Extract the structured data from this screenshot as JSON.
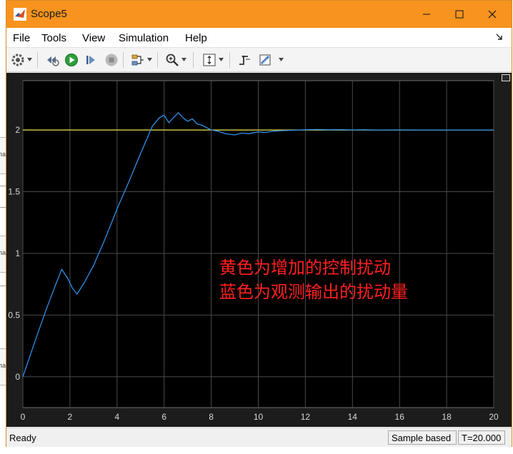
{
  "window": {
    "title": "Scope5"
  },
  "menu": [
    "File",
    "Tools",
    "View",
    "Simulation",
    "Help"
  ],
  "toolbar": {
    "icons": [
      "gear-icon",
      "restore-sim-icon",
      "run-icon",
      "step-forward-icon",
      "stop-icon",
      "signal-highlight-icon",
      "zoom-icon",
      "autoscale-icon",
      "trigger-icon",
      "measure-icon"
    ]
  },
  "annotation": {
    "line1": "黄色为增加的控制扰动",
    "line2": "蓝色为观测输出的扰动量"
  },
  "status": {
    "ready": "Ready",
    "mode": "Sample based",
    "time": "T=20.000"
  },
  "colors": {
    "title_bar": "#f7931e",
    "plot_bg": "#000000",
    "grid": "#4a4a4a",
    "series_blue": "#2e8fe6",
    "series_yellow": "#e8e24a",
    "annotation": "#ff2020"
  },
  "chart_data": {
    "type": "line",
    "xlim": [
      0,
      20
    ],
    "ylim": [
      -0.25,
      2.4
    ],
    "xticks": [
      0,
      2,
      4,
      6,
      8,
      10,
      12,
      14,
      16,
      18,
      20
    ],
    "yticks": [
      0,
      0.5,
      1,
      1.5,
      2
    ],
    "grid": true,
    "series": [
      {
        "color": "#e8e24a",
        "x": [
          0,
          20
        ],
        "y": [
          2,
          2
        ]
      },
      {
        "color": "#2e8fe6",
        "x": [
          0,
          0.5,
          1.0,
          1.4,
          1.65,
          1.9,
          2.1,
          2.3,
          2.6,
          3.0,
          3.5,
          4.0,
          4.5,
          5.0,
          5.5,
          5.8,
          6.0,
          6.2,
          6.4,
          6.6,
          6.8,
          7.0,
          7.2,
          7.4,
          7.6,
          7.8,
          8.0,
          8.3,
          8.6,
          9.0,
          9.3,
          9.6,
          10.0,
          10.3,
          10.6,
          11.0,
          11.5,
          12.0,
          12.5,
          13.0,
          13.5,
          14.0,
          14.5,
          15.0,
          16.0,
          17.0,
          18.0,
          19.0,
          20.0
        ],
        "y": [
          0.0,
          0.28,
          0.55,
          0.75,
          0.87,
          0.8,
          0.72,
          0.67,
          0.76,
          0.9,
          1.12,
          1.36,
          1.58,
          1.81,
          2.03,
          2.1,
          2.12,
          2.06,
          2.1,
          2.14,
          2.1,
          2.07,
          2.09,
          2.05,
          2.04,
          2.02,
          2.0,
          1.99,
          1.97,
          1.96,
          1.975,
          1.97,
          1.985,
          1.98,
          1.99,
          1.995,
          1.998,
          2.002,
          2.004,
          2.002,
          2.003,
          2.001,
          2.002,
          2.0,
          2.001,
          2.0,
          2.0,
          2.0,
          2.0
        ]
      }
    ]
  }
}
